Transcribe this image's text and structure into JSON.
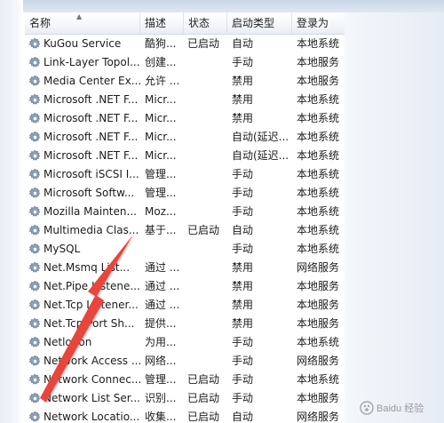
{
  "columns": {
    "name": "名称",
    "desc": "描述",
    "status": "状态",
    "startup": "启动类型",
    "logon": "登录为"
  },
  "rows": [
    {
      "name": "KuGou Service",
      "desc": "酷狗...",
      "status": "已启动",
      "startup": "自动",
      "logon": "本地系统"
    },
    {
      "name": "Link-Layer Topol...",
      "desc": "创建...",
      "status": "",
      "startup": "手动",
      "logon": "本地服务"
    },
    {
      "name": "Media Center Ex...",
      "desc": "允许 ...",
      "status": "",
      "startup": "禁用",
      "logon": "本地服务"
    },
    {
      "name": "Microsoft .NET F...",
      "desc": "Micr...",
      "status": "",
      "startup": "禁用",
      "logon": "本地系统"
    },
    {
      "name": "Microsoft .NET F...",
      "desc": "Micr...",
      "status": "",
      "startup": "禁用",
      "logon": "本地系统"
    },
    {
      "name": "Microsoft .NET F...",
      "desc": "Micr...",
      "status": "",
      "startup": "自动(延迟...",
      "logon": "本地系统"
    },
    {
      "name": "Microsoft .NET F...",
      "desc": "Micr...",
      "status": "",
      "startup": "自动(延迟...",
      "logon": "本地系统"
    },
    {
      "name": "Microsoft iSCSI I...",
      "desc": "管理...",
      "status": "",
      "startup": "手动",
      "logon": "本地系统"
    },
    {
      "name": "Microsoft Softw...",
      "desc": "管理...",
      "status": "",
      "startup": "手动",
      "logon": "本地系统"
    },
    {
      "name": "Mozilla Mainten...",
      "desc": "Moz...",
      "status": "",
      "startup": "手动",
      "logon": "本地系统"
    },
    {
      "name": "Multimedia Clas...",
      "desc": "基于...",
      "status": "已启动",
      "startup": "自动",
      "logon": "本地系统"
    },
    {
      "name": "MySQL",
      "desc": "",
      "status": "",
      "startup": "手动",
      "logon": "本地系统"
    },
    {
      "name": "Net.Msmq List...",
      "desc": "通过 ...",
      "status": "",
      "startup": "禁用",
      "logon": "网络服务"
    },
    {
      "name": "Net.Pipe Listene...",
      "desc": "通过 ...",
      "status": "",
      "startup": "禁用",
      "logon": "本地服务"
    },
    {
      "name": "Net.Tcp Listener...",
      "desc": "通过 ...",
      "status": "",
      "startup": "禁用",
      "logon": "本地服务"
    },
    {
      "name": "Net.Tcp Port Sh...",
      "desc": "提供...",
      "status": "",
      "startup": "禁用",
      "logon": "本地服务"
    },
    {
      "name": "Netlogon",
      "desc": "为用...",
      "status": "",
      "startup": "手动",
      "logon": "本地系统"
    },
    {
      "name": "Network Access ...",
      "desc": "网络...",
      "status": "",
      "startup": "手动",
      "logon": "网络服务"
    },
    {
      "name": "Network Connec...",
      "desc": "管理...",
      "status": "已启动",
      "startup": "手动",
      "logon": "本地系统"
    },
    {
      "name": "Network List Ser...",
      "desc": "识别...",
      "status": "已启动",
      "startup": "手动",
      "logon": "本地服务"
    },
    {
      "name": "Network Locatio...",
      "desc": "收集...",
      "status": "已启动",
      "startup": "自动",
      "logon": "网络服务"
    }
  ],
  "annotation": {
    "arrow_color": "#e8453c"
  },
  "watermark": {
    "text": "Baidu 经验"
  },
  "icons": {
    "service": "gear-icon"
  }
}
